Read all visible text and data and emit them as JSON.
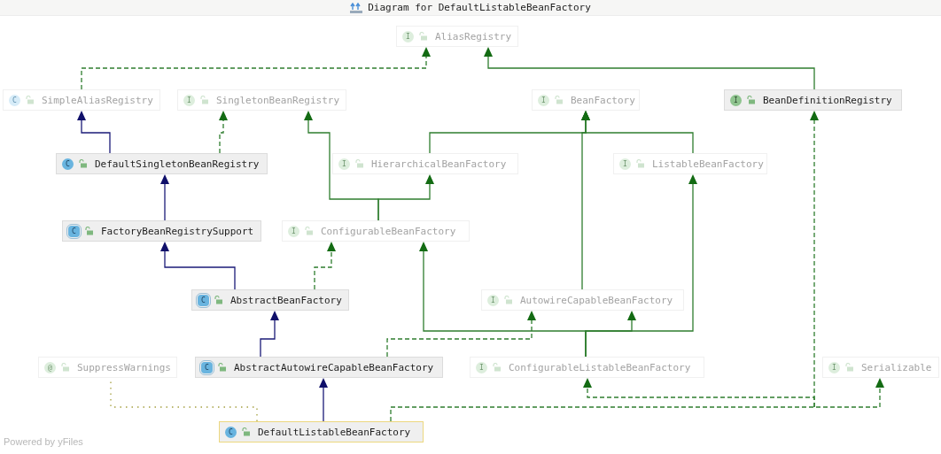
{
  "window": {
    "title": "Diagram for DefaultListableBeanFactory"
  },
  "nodes": [
    {
      "name": "AliasRegistry",
      "kind": "interface",
      "badge": "I",
      "faded": true,
      "selected": false
    },
    {
      "name": "SimpleAliasRegistry",
      "kind": "class",
      "badge": "C",
      "faded": true,
      "selected": false
    },
    {
      "name": "SingletonBeanRegistry",
      "kind": "interface",
      "badge": "I",
      "faded": true,
      "selected": false
    },
    {
      "name": "BeanFactory",
      "kind": "interface",
      "badge": "I",
      "faded": true,
      "selected": false
    },
    {
      "name": "BeanDefinitionRegistry",
      "kind": "interface",
      "badge": "I",
      "faded": false,
      "selected": false
    },
    {
      "name": "DefaultSingletonBeanRegistry",
      "kind": "class",
      "badge": "C",
      "faded": false,
      "selected": false
    },
    {
      "name": "HierarchicalBeanFactory",
      "kind": "interface",
      "badge": "I",
      "faded": true,
      "selected": false
    },
    {
      "name": "ListableBeanFactory",
      "kind": "interface",
      "badge": "I",
      "faded": true,
      "selected": false
    },
    {
      "name": "FactoryBeanRegistrySupport",
      "kind": "abstract",
      "badge": "C",
      "faded": false,
      "selected": false
    },
    {
      "name": "ConfigurableBeanFactory",
      "kind": "interface",
      "badge": "I",
      "faded": true,
      "selected": false
    },
    {
      "name": "AbstractBeanFactory",
      "kind": "abstract",
      "badge": "C",
      "faded": false,
      "selected": false
    },
    {
      "name": "AutowireCapableBeanFactory",
      "kind": "interface",
      "badge": "I",
      "faded": true,
      "selected": false
    },
    {
      "name": "SuppressWarnings",
      "kind": "annotation",
      "badge": "@",
      "faded": true,
      "selected": false
    },
    {
      "name": "AbstractAutowireCapableBeanFactory",
      "kind": "abstract",
      "badge": "C",
      "faded": false,
      "selected": false
    },
    {
      "name": "ConfigurableListableBeanFactory",
      "kind": "interface",
      "badge": "I",
      "faded": true,
      "selected": false
    },
    {
      "name": "Serializable",
      "kind": "interface",
      "badge": "I",
      "faded": true,
      "selected": false
    },
    {
      "name": "DefaultListableBeanFactory",
      "kind": "class",
      "badge": "C",
      "faded": false,
      "selected": true
    }
  ],
  "edges": [
    {
      "kind": "implements"
    },
    {
      "kind": "interface-extends"
    },
    {
      "kind": "extends"
    },
    {
      "kind": "implements"
    },
    {
      "kind": "interface-extends"
    },
    {
      "kind": "interface-extends"
    },
    {
      "kind": "interface-extends"
    },
    {
      "kind": "interface-extends"
    },
    {
      "kind": "interface-extends"
    },
    {
      "kind": "extends"
    },
    {
      "kind": "extends"
    },
    {
      "kind": "implements"
    },
    {
      "kind": "interface-extends"
    },
    {
      "kind": "interface-extends"
    },
    {
      "kind": "interface-extends"
    },
    {
      "kind": "extends"
    },
    {
      "kind": "implements"
    },
    {
      "kind": "extends"
    },
    {
      "kind": "implements"
    },
    {
      "kind": "implements"
    },
    {
      "kind": "implements"
    },
    {
      "kind": "annotation"
    }
  ],
  "footer": "Powered by yFiles"
}
